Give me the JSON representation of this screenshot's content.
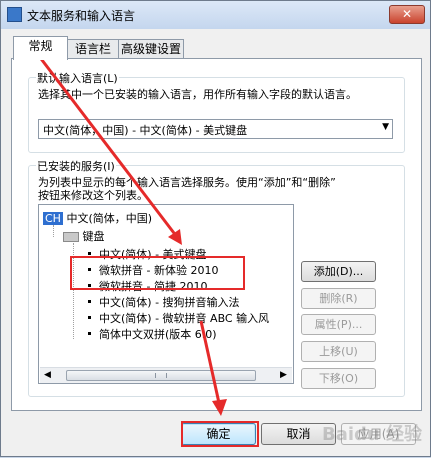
{
  "window": {
    "title": "文本服务和输入语言",
    "close_glyph": "✕"
  },
  "tabs": [
    {
      "label": "常规",
      "active": true
    },
    {
      "label": "语言栏",
      "active": false
    },
    {
      "label": "高级键设置",
      "active": false
    }
  ],
  "default_language": {
    "group_label": "默认输入语言(L)",
    "description": "选择其中一个已安装的输入语言，用作所有输入字段的默认语言。",
    "selected": "中文(简体，中国) - 中文(简体) - 美式键盘"
  },
  "installed_services": {
    "group_label": "已安装的服务(I)",
    "description_line1": "为列表中显示的每个输入语言选择服务。使用“添加”和“删除”",
    "description_line2": "按钮来修改这个列表。",
    "tree": {
      "language_badge": "CH",
      "language": "中文(简体，中国)",
      "keyboard_group": "键盘",
      "items": [
        "中文(简体) - 美式键盘",
        "微软拼音 - 新体验 2010",
        "微软拼音 - 简捷 2010",
        "中文(简体) - 搜狗拼音输入法",
        "中文(简体) - 微软拼音 ABC 输入风",
        "简体中文双拼(版本 6.0)"
      ]
    }
  },
  "side_buttons": {
    "add": "添加(D)...",
    "remove": "删除(R)",
    "properties": "属性(P)...",
    "move_up": "上移(U)",
    "move_down": "下移(O)"
  },
  "bottom_buttons": {
    "ok": "确定",
    "cancel": "取消",
    "apply": "应用(A)"
  },
  "watermark": "Baidu 经验",
  "colors": {
    "annotation_red": "#e52a2a",
    "badge_blue": "#2e6fd0"
  },
  "icons": {
    "app": "keyboard-app-icon",
    "keyboard": "keyboard-icon",
    "close": "close-icon"
  }
}
